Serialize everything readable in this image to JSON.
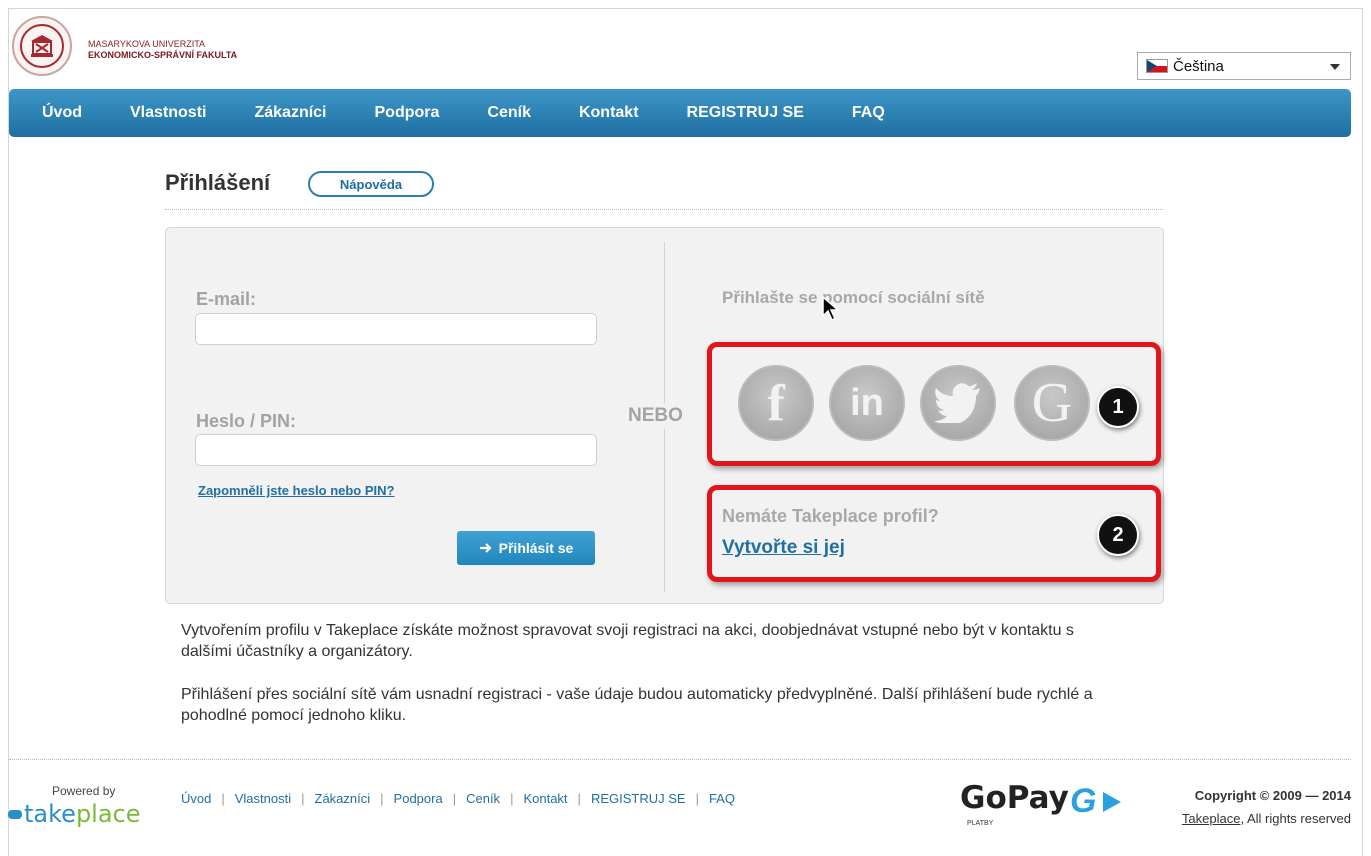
{
  "header": {
    "university_line1": "MASARYKOVA UNIVERZITA",
    "university_line2": "EKONOMICKO-SPRÁVNÍ FAKULTA",
    "language": "Čeština"
  },
  "nav": {
    "items": [
      "Úvod",
      "Vlastnosti",
      "Zákazníci",
      "Podpora",
      "Ceník",
      "Kontakt",
      "REGISTRUJ SE",
      "FAQ"
    ]
  },
  "login": {
    "title": "Přihlášení",
    "help_label": "Nápověda",
    "email_label": "E-mail:",
    "email_value": "",
    "password_label": "Heslo / PIN:",
    "password_value": "",
    "forgot_link": "Zapomněli jste heslo nebo PIN?",
    "submit_label": "Přihlásit se",
    "or_text": "NEBO",
    "social_title": "Přihlašte se pomocí sociální sítě",
    "no_profile": "Nemáte Takeplace profil?",
    "create_link": "Vytvořte si jej"
  },
  "annotations": {
    "badge1": "1",
    "badge2": "2"
  },
  "description": {
    "p1": "Vytvořením profilu v Takeplace získáte možnost spravovat svoji registraci na akci, doobjednávat vstupné nebo být v kontaktu s dalšími účastníky a organizátory.",
    "p2": "Přihlášení přes sociální sítě vám usnadní registraci - vaše údaje budou automaticky předvyplněné. Další přihlášení bude rychlé a pohodlné pomocí jednoho kliku."
  },
  "footer": {
    "powered_by": "Powered by",
    "brand_take": "take",
    "brand_place": "place",
    "nav": [
      "Úvod",
      "Vlastnosti",
      "Zákazníci",
      "Podpora",
      "Ceník",
      "Kontakt",
      "REGISTRUJ SE",
      "FAQ"
    ],
    "gopay": "GoPay",
    "gopay_sub": "PLATBY",
    "copyright": "Copyright © 2009 — 2014",
    "rights_link": "Takeplace",
    "rights_text": ", All rights reserved"
  },
  "colors": {
    "nav_blue": "#1f6fa2",
    "accent_red": "#e0161b",
    "brand_green": "#7cb83a"
  },
  "icons": [
    "university-logo",
    "czech-flag-icon",
    "chevron-down-icon",
    "arrow-right-icon",
    "facebook-icon",
    "linkedin-icon",
    "twitter-icon",
    "google-icon",
    "mouse-cursor-icon"
  ]
}
